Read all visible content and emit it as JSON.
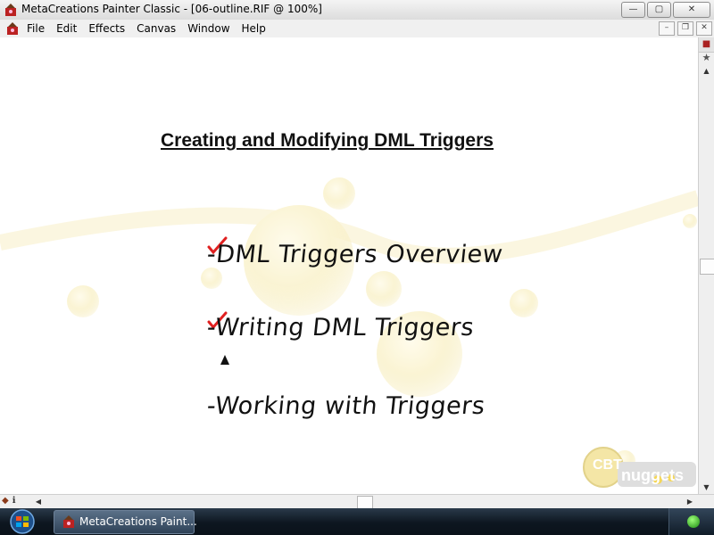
{
  "window": {
    "title": "MetaCreations Painter Classic - [06-outline.RIF @ 100%]",
    "app_icon": "painter-app-icon",
    "buttons": {
      "minimize": "—",
      "maximize": "▢",
      "close": "✕"
    }
  },
  "menubar": {
    "items": [
      "File",
      "Edit",
      "Effects",
      "Canvas",
      "Window",
      "Help"
    ],
    "mdi_buttons": {
      "minimize": "–",
      "restore": "❐",
      "close": "✕"
    }
  },
  "slide": {
    "title": "Creating and Modifying DML Triggers",
    "bullets": [
      {
        "text": "-DML Triggers Overview",
        "checked": true
      },
      {
        "text": "-Writing DML Triggers",
        "checked": true
      },
      {
        "text": "-Working with Triggers",
        "checked": false
      }
    ],
    "logo": {
      "part1": "CBT",
      "part2": "nuggets"
    }
  },
  "scrollbars": {
    "up": "▲",
    "down": "▼",
    "left": "◀",
    "right": "▶",
    "star": "★"
  },
  "taskbar": {
    "task_label": "MetaCreations Paint..."
  },
  "colors": {
    "check_red": "#e02020",
    "bubble": "#f7e9a8",
    "accent": "#2f4257"
  }
}
